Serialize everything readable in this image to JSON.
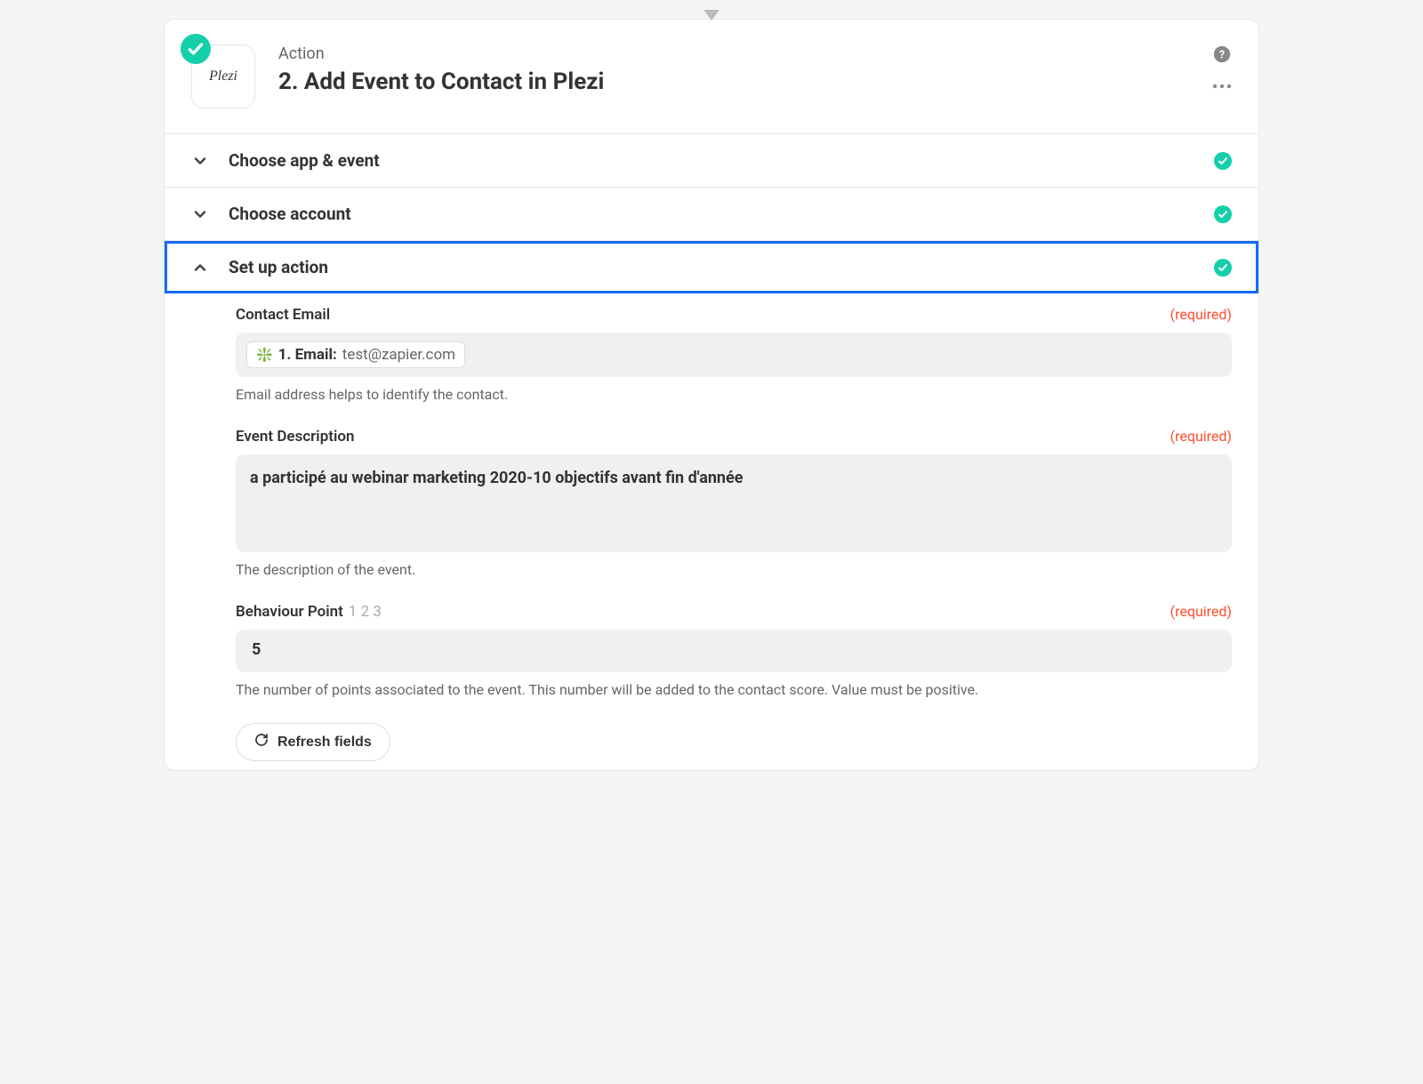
{
  "header": {
    "eyebrow": "Action",
    "title": "2. Add Event to Contact in Plezi",
    "app_logo_text": "Plezi"
  },
  "sections": {
    "choose_app": {
      "title": "Choose app & event"
    },
    "choose_account": {
      "title": "Choose account"
    },
    "setup_action": {
      "title": "Set up action"
    }
  },
  "labels": {
    "required": "(required)"
  },
  "fields": {
    "contact_email": {
      "label": "Contact Email",
      "pill_prefix": "1. Email:",
      "pill_value": "test@zapier.com",
      "helper": "Email address helps to identify the contact."
    },
    "event_description": {
      "label": "Event Description",
      "value": "a participé au webinar marketing 2020-10 objectifs avant fin d'année",
      "helper": "The description of the event."
    },
    "behaviour_point": {
      "label": "Behaviour Point",
      "label_hint": "1 2 3",
      "value": "5",
      "helper": "The number of points associated to the event. This number will be added to the contact score. Value must be positive."
    }
  },
  "buttons": {
    "refresh_fields": "Refresh fields"
  }
}
